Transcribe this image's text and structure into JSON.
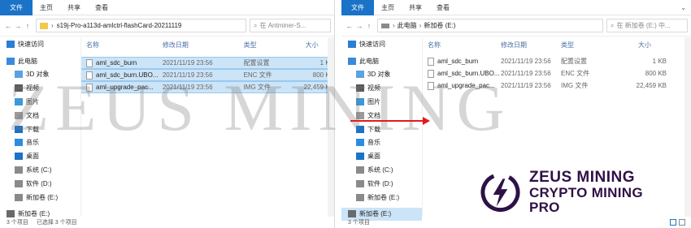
{
  "left_window": {
    "tabs": [
      "文件",
      "主页",
      "共享",
      "查看"
    ],
    "path": "s19j-Pro-a113d-amlctrl-flashCard-20211119",
    "search_placeholder": "在 Antminer-S...",
    "columns": {
      "name": "名称",
      "date": "修改日期",
      "type": "类型",
      "size": "大小"
    },
    "sidebar": [
      {
        "label": "快速访问",
        "icon": "star-icon"
      },
      {
        "label": "此电脑",
        "icon": "computer-icon"
      },
      {
        "label": "3D 对象",
        "icon": "cube-icon"
      },
      {
        "label": "视频",
        "icon": "video-icon"
      },
      {
        "label": "图片",
        "icon": "picture-icon"
      },
      {
        "label": "文档",
        "icon": "document-icon"
      },
      {
        "label": "下载",
        "icon": "download-icon"
      },
      {
        "label": "音乐",
        "icon": "music-icon"
      },
      {
        "label": "桌面",
        "icon": "desktop-icon"
      },
      {
        "label": "系统 (C:)",
        "icon": "drive-icon"
      },
      {
        "label": "软件 (D:)",
        "icon": "drive-icon"
      },
      {
        "label": "新加卷 (E:)",
        "icon": "drive-icon"
      },
      {
        "label": "新加卷 (E:)",
        "icon": "usb-drive-icon"
      }
    ],
    "files": [
      {
        "name": "aml_sdc_burn",
        "date": "2021/11/19 23:56",
        "type": "配置设置",
        "size": "1 KB"
      },
      {
        "name": "aml_sdc_burn.UBO...",
        "date": "2021/11/19 23:56",
        "type": "ENC 文件",
        "size": "800 KB"
      },
      {
        "name": "aml_upgrade_pac...",
        "date": "2021/11/19 23:56",
        "type": "IMG 文件",
        "size": "22,459 KB"
      }
    ],
    "status": [
      "3 个项目",
      "已选择 3 个项目"
    ]
  },
  "right_window": {
    "tabs": [
      "文件",
      "主页",
      "共享",
      "查看"
    ],
    "path": [
      "此电脑",
      "新加卷 (E:)"
    ],
    "search_placeholder": "在 新加卷 (E:) 中...",
    "columns": {
      "name": "名称",
      "date": "修改日期",
      "type": "类型",
      "size": "大小"
    },
    "sidebar": [
      {
        "label": "快速访问",
        "icon": "star-icon"
      },
      {
        "label": "此电脑",
        "icon": "computer-icon"
      },
      {
        "label": "3D 对象",
        "icon": "cube-icon"
      },
      {
        "label": "视频",
        "icon": "video-icon"
      },
      {
        "label": "图片",
        "icon": "picture-icon"
      },
      {
        "label": "文档",
        "icon": "document-icon"
      },
      {
        "label": "下载",
        "icon": "download-icon"
      },
      {
        "label": "音乐",
        "icon": "music-icon"
      },
      {
        "label": "桌面",
        "icon": "desktop-icon"
      },
      {
        "label": "系统 (C:)",
        "icon": "drive-icon"
      },
      {
        "label": "软件 (D:)",
        "icon": "drive-icon"
      },
      {
        "label": "新加卷 (E:)",
        "icon": "drive-icon"
      },
      {
        "label": "新加卷 (E:)",
        "icon": "usb-drive-icon"
      }
    ],
    "files": [
      {
        "name": "aml_sdc_burn",
        "date": "2021/11/19 23:56",
        "type": "配置设置",
        "size": "1 KB"
      },
      {
        "name": "aml_sdc_burn.UBO...",
        "date": "2021/11/19 23:56",
        "type": "ENC 文件",
        "size": "800 KB"
      },
      {
        "name": "aml_upgrade_pac...",
        "date": "2021/11/19 23:56",
        "type": "IMG 文件",
        "size": "22,459 KB"
      }
    ],
    "status": [
      "3 个项目"
    ]
  },
  "watermark": "ZEUS MINING",
  "brand": {
    "line1": "ZEUS MINING",
    "line2": "CRYPTO MINING PRO",
    "color": "#2e1146"
  },
  "colors": {
    "accent": "#1a73c7",
    "selection": "#cce4f7",
    "arrow": "#e21b1b"
  }
}
